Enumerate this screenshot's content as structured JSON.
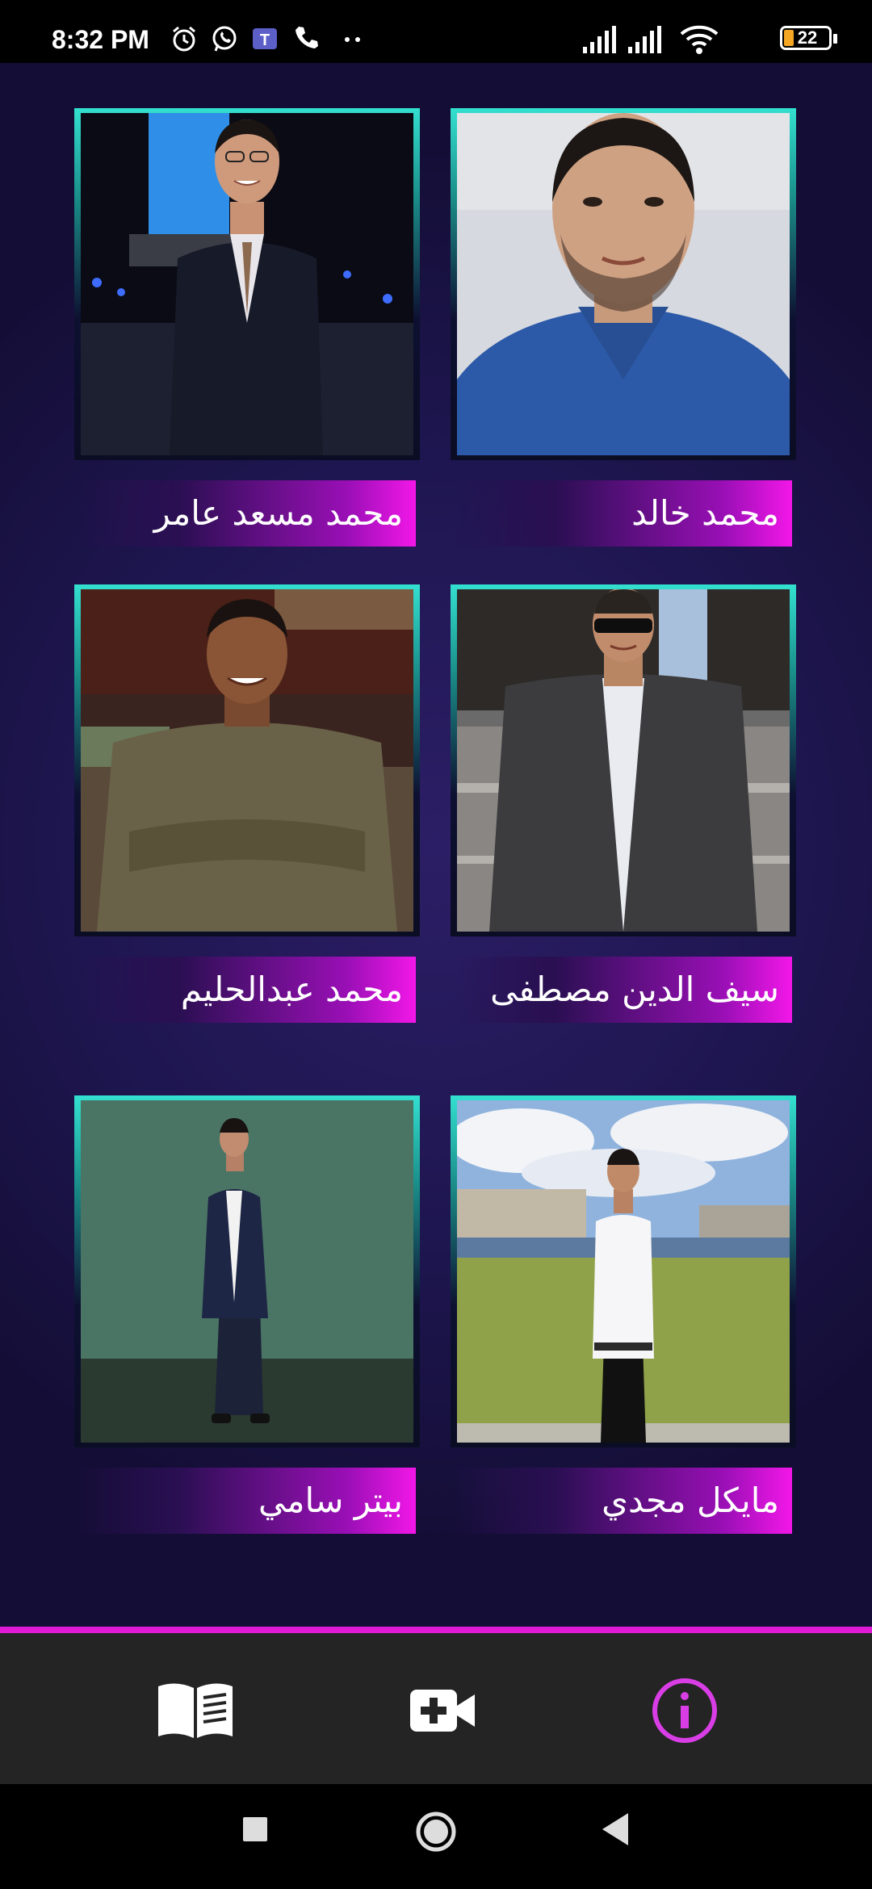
{
  "status_bar": {
    "time": "8:32 PM",
    "battery_level": "22",
    "icons": [
      "alarm-icon",
      "whatsapp-icon",
      "teams-icon",
      "phone-icon",
      "more-dots-icon",
      "signal-icon",
      "signal-icon",
      "wifi-icon",
      "battery-icon"
    ]
  },
  "team": [
    {
      "name": "محمد خالد",
      "photo": "photo-mohamed-khaled"
    },
    {
      "name": "محمد مسعد عامر",
      "photo": "photo-mohamed-mosaad-amer"
    },
    {
      "name": "سيف الدين مصطفى",
      "photo": "photo-seif-eldin-mostafa"
    },
    {
      "name": "محمد عبدالحليم",
      "photo": "photo-mohamed-abdelhalim"
    },
    {
      "name": "مايكل مجدي",
      "photo": "photo-michael-magdy"
    },
    {
      "name": "بيتر سامي",
      "photo": "photo-peter-samy"
    }
  ],
  "bottom_nav": {
    "items": [
      {
        "icon": "book-icon",
        "active": false
      },
      {
        "icon": "video-add-icon",
        "active": false
      },
      {
        "icon": "info-icon",
        "active": true
      }
    ],
    "active_color": "#d93ee6",
    "inactive_color": "#ffffff"
  },
  "colors": {
    "accent_magenta": "#e11ad8",
    "accent_teal": "#33e0d0",
    "background": "#1e1650"
  }
}
